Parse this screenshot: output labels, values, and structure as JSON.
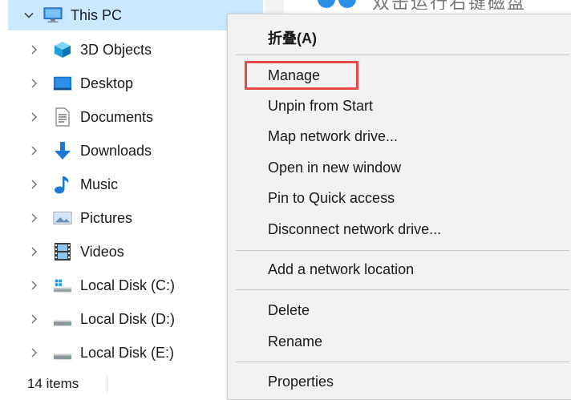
{
  "tree": {
    "root": {
      "label": "This PC",
      "icon": "monitor-icon",
      "expanded": true
    },
    "items": [
      {
        "label": "3D Objects",
        "icon": "cube-icon"
      },
      {
        "label": "Desktop",
        "icon": "desktop-icon"
      },
      {
        "label": "Documents",
        "icon": "document-icon"
      },
      {
        "label": "Downloads",
        "icon": "download-arrow-icon"
      },
      {
        "label": "Music",
        "icon": "music-note-icon"
      },
      {
        "label": "Pictures",
        "icon": "pictures-icon"
      },
      {
        "label": "Videos",
        "icon": "film-icon"
      },
      {
        "label": "Local Disk (C:)",
        "icon": "windows-drive-icon"
      },
      {
        "label": "Local Disk (D:)",
        "icon": "drive-icon"
      },
      {
        "label": "Local Disk (E:)",
        "icon": "drive-icon"
      }
    ]
  },
  "status": {
    "item_count": "14 items"
  },
  "context_menu": {
    "collapse": "折叠(A)",
    "manage": "Manage",
    "unpin": "Unpin from Start",
    "map_drive": "Map network drive...",
    "open_new_window": "Open in new window",
    "pin_quick": "Pin to Quick access",
    "disconnect": "Disconnect network drive...",
    "add_network": "Add a network location",
    "delete": "Delete",
    "rename": "Rename",
    "properties": "Properties"
  },
  "background": {
    "peek_text": "双击运行右键磁盘"
  },
  "colors": {
    "selection": "#cce8ff",
    "menu_bg": "#f2f2f2",
    "highlight": "#e84a4a"
  }
}
